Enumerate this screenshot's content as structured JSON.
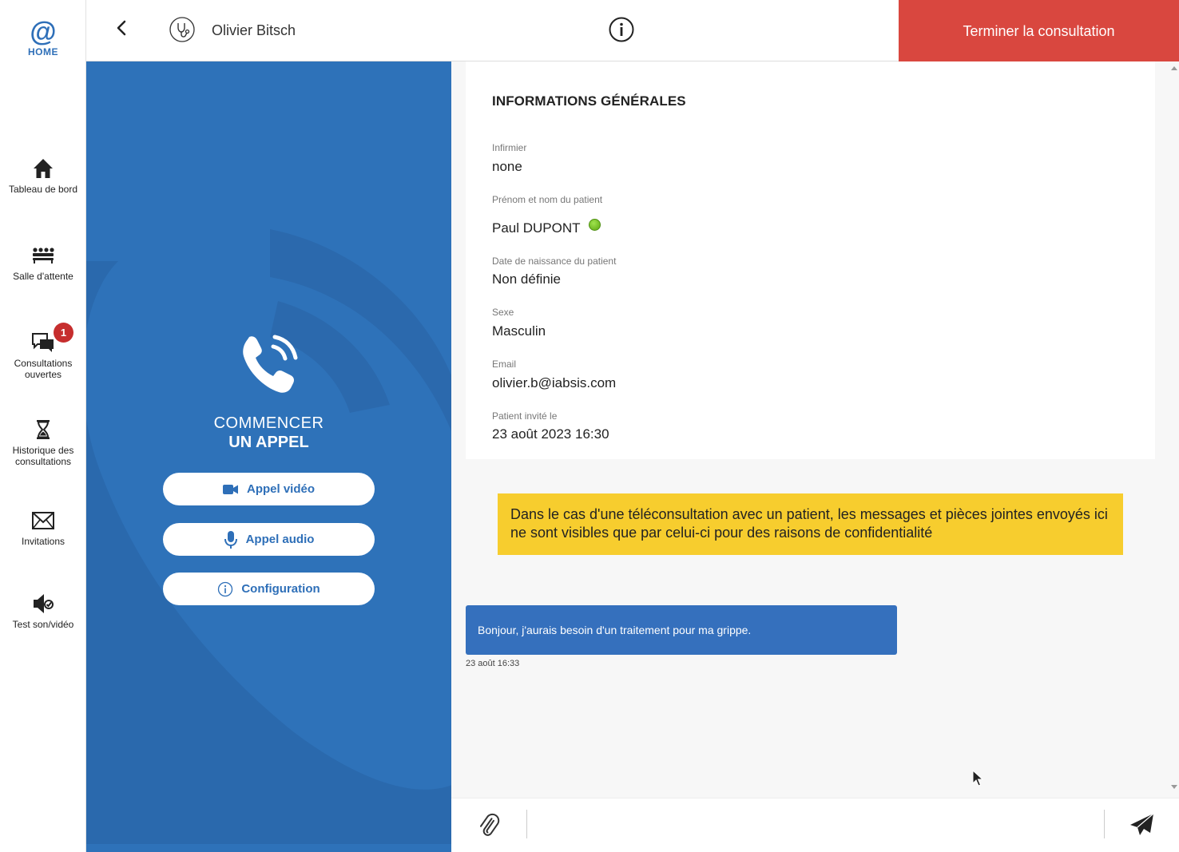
{
  "sidebar": {
    "logo": {
      "symbol": "@",
      "label": "HOME"
    },
    "items": [
      {
        "id": "dashboard",
        "label": "Tableau de bord",
        "icon": "home-icon"
      },
      {
        "id": "waiting-room",
        "label": "Salle d'attente",
        "icon": "waiting-room-icon"
      },
      {
        "id": "open-consultations",
        "label": "Consultations ouvertes",
        "icon": "chat-icon",
        "badge": "1"
      },
      {
        "id": "history",
        "label": "Historique des consultations",
        "icon": "hourglass-icon"
      },
      {
        "id": "invitations",
        "label": "Invitations",
        "icon": "envelope-icon"
      },
      {
        "id": "test",
        "label": "Test son/vidéo",
        "icon": "speaker-check-icon"
      }
    ]
  },
  "header": {
    "doctor_name": "Olivier Bitsch",
    "end_button": "Terminer la consultation"
  },
  "call_panel": {
    "title_line1": "COMMENCER",
    "title_line2": "UN APPEL",
    "buttons": {
      "video": "Appel vidéo",
      "audio": "Appel audio",
      "config": "Configuration"
    }
  },
  "info": {
    "title": "INFORMATIONS GÉNÉRALES",
    "nurse_label": "Infirmier",
    "nurse_value": "none",
    "patient_label": "Prénom et nom du patient",
    "patient_value": "Paul DUPONT",
    "patient_status": "online",
    "birth_label": "Date de naissance du patient",
    "birth_value": "Non définie",
    "sex_label": "Sexe",
    "sex_value": "Masculin",
    "email_label": "Email",
    "email_value": "olivier.b@iabsis.com",
    "invited_label": "Patient invité le",
    "invited_value": "23 août 2023 16:30"
  },
  "chat": {
    "notice": "Dans le cas d'une téléconsultation avec un patient, les messages et pièces jointes envoyés ici ne sont visibles que par celui-ci pour des raisons de confidentialité",
    "messages": [
      {
        "text": "Bonjour, j'aurais besoin d'un traitement pour ma grippe.",
        "time": "23 août 16:33"
      }
    ],
    "input_value": ""
  },
  "colors": {
    "primary": "#2e72b9",
    "danger": "#d9473f",
    "notice": "#f7cd2e",
    "badge": "#c62e2e",
    "bubble": "#3570bd"
  }
}
